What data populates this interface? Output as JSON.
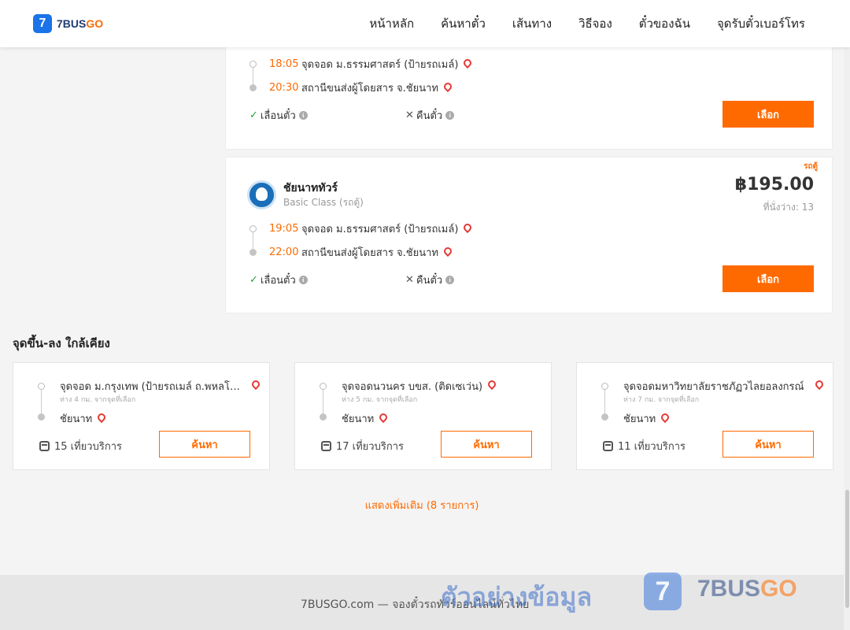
{
  "header": {
    "logo_mark": "7",
    "logo_text_a": "7BUS",
    "logo_text_b": "GO",
    "nav": [
      "หน้าหลัก",
      "ค้นหาตั๋ว",
      "เส้นทาง",
      "วิธีจอง",
      "ตั๋วของฉัน",
      "จุดรับตั๋วเบอร์โทร"
    ]
  },
  "trips": [
    {
      "depart_time": "18:05",
      "depart_place": "จุดจอด ม.ธรรมศาสตร์ (ป้ายรถเมล์)",
      "arrive_time": "20:30",
      "arrive_place": "สถานีขนส่งผู้โดยสาร จ.ชัยนาท",
      "policy_change": "เลื่อนตั๋ว",
      "policy_refund": "คืนตั๋ว",
      "select_label": "เลือก"
    },
    {
      "company": "ชัยนาททัวร์",
      "bus_class": "Basic Class (รถตู้)",
      "vehicle_tag": "รถตู้",
      "price": "฿195.00",
      "seats": "ที่นั่งว่าง: 13",
      "depart_time": "19:05",
      "depart_place": "จุดจอด ม.ธรรมศาสตร์ (ป้ายรถเมล์)",
      "arrive_time": "22:00",
      "arrive_place": "สถานีขนส่งผู้โดยสาร จ.ชัยนาท",
      "policy_change": "เลื่อนตั๋ว",
      "policy_refund": "คืนตั๋ว",
      "select_label": "เลือก"
    }
  ],
  "nearby": {
    "title": "จุดขึ้น-ลง ใกล้เคียง",
    "cards": [
      {
        "name": "จุดจอด ม.กรุงเทพ (ป้ายรถเมล์ ถ.พหลโยธิน)",
        "distance": "ห่าง 4 กม. จากจุดที่เลือก",
        "dest": "ชัยนาท",
        "trips": "15 เที่ยวบริการ",
        "button": "ค้นหา"
      },
      {
        "name": "จุดจอดนวนคร บขส. (ติดเซเว่น)",
        "distance": "ห่าง 5 กม. จากจุดที่เลือก",
        "dest": "ชัยนาท",
        "trips": "17 เที่ยวบริการ",
        "button": "ค้นหา"
      },
      {
        "name": "จุดจอดมหาวิทยาลัยราชภัฏวไลยอลงกรณ์",
        "distance": "ห่าง 7 กม. จากจุดที่เลือก",
        "dest": "ชัยนาท",
        "trips": "11 เที่ยวบริการ",
        "button": "ค้นหา"
      }
    ],
    "show_more": "แสดงเพิ่มเติม (8 รายการ)"
  },
  "footer": {
    "text": "7BUSGO.com — จองตั๋วรถทัวร์ออนไลน์ทั่วไทย",
    "watermark": "ตัวอย่างข้อมูล",
    "watermark_logo": "7",
    "watermark_brand_a": "7BUS",
    "watermark_brand_b": "GO"
  },
  "colors": {
    "accent": "#ff6a00",
    "brand_blue": "#1a73e8",
    "pin": "#e53935"
  }
}
